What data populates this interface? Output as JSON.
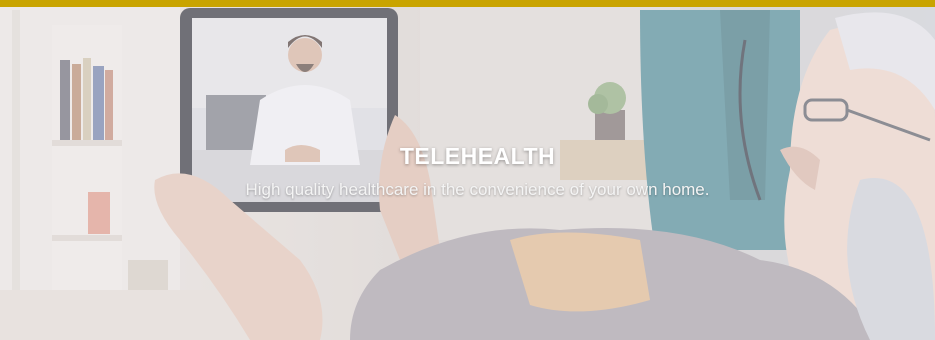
{
  "banner": {
    "accent_color": "#c9a400",
    "title": "TELEHEALTH",
    "subtitle": "High quality healthcare in the convenience of your own home."
  },
  "photo": {
    "subject": "elderly-patient-video-call-with-doctor-on-tablet"
  }
}
